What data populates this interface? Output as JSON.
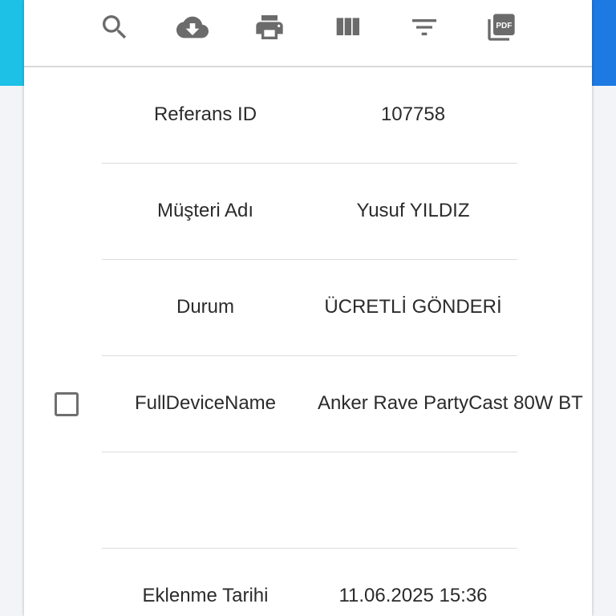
{
  "toolbar": {
    "icons": [
      "search-icon",
      "cloud-download-icon",
      "print-icon",
      "view-columns-icon",
      "filter-icon",
      "pdf-icon"
    ],
    "pdf_text": "PDF"
  },
  "rows": [
    {
      "label": "Referans ID",
      "value": "107758"
    },
    {
      "label": "Müşteri Adı",
      "value": "Yusuf YILDIZ"
    },
    {
      "label": "Durum",
      "value": "ÜCRETLİ GÖNDERİ"
    },
    {
      "label": "FullDeviceName",
      "value": "Anker Rave PartyCast 80W BT",
      "checked": false
    },
    {
      "label": "",
      "value": ""
    },
    {
      "label": "Eklenme Tarihi",
      "value": "11.06.2025 15:36"
    }
  ],
  "colors": {
    "accent_left": "#1ec1e6",
    "accent_right": "#1d7ae3",
    "icon": "#6b6b6b",
    "text": "#2b2b2b"
  }
}
